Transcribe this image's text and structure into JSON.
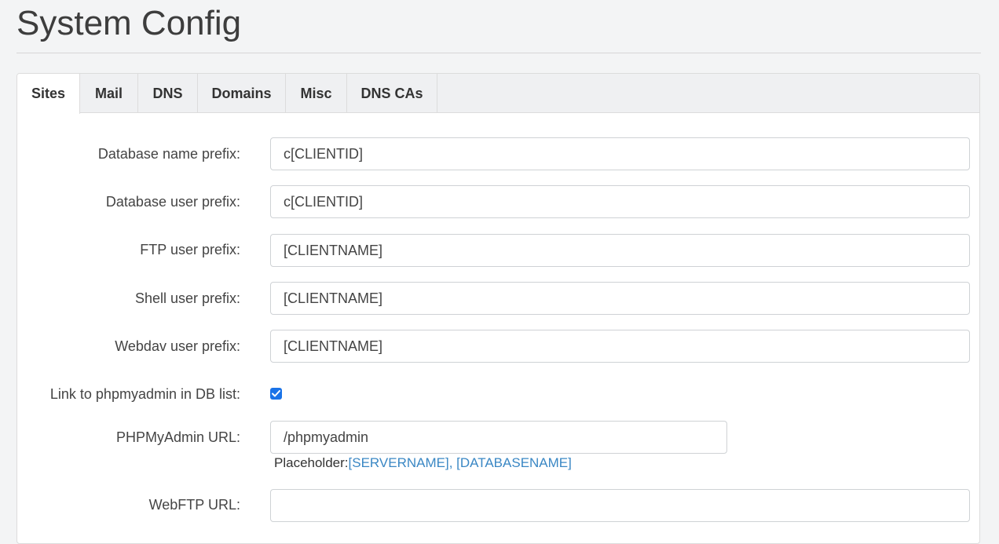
{
  "page": {
    "title": "System Config"
  },
  "tabs": [
    {
      "label": "Sites",
      "active": true
    },
    {
      "label": "Mail",
      "active": false
    },
    {
      "label": "DNS",
      "active": false
    },
    {
      "label": "Domains",
      "active": false
    },
    {
      "label": "Misc",
      "active": false
    },
    {
      "label": "DNS CAs",
      "active": false
    }
  ],
  "form": {
    "db_name_prefix": {
      "label": "Database name prefix:",
      "value": "c[CLIENTID]"
    },
    "db_user_prefix": {
      "label": "Database user prefix:",
      "value": "c[CLIENTID]"
    },
    "ftp_user_prefix": {
      "label": "FTP user prefix:",
      "value": "[CLIENTNAME]"
    },
    "shell_user_prefix": {
      "label": "Shell user prefix:",
      "value": "[CLIENTNAME]"
    },
    "webdav_user_prefix": {
      "label": "Webdav user prefix:",
      "value": "[CLIENTNAME]"
    },
    "phpmyadmin_link": {
      "label": "Link to phpmyadmin in DB list:",
      "checked": true
    },
    "phpmyadmin_url": {
      "label": "PHPMyAdmin URL:",
      "value": "/phpmyadmin",
      "hint_prefix": "Placeholder:",
      "hint_placeholder_1": "[SERVERNAME]",
      "hint_separator": ", ",
      "hint_placeholder_2": "[DATABASENAME]"
    },
    "webftp_url": {
      "label": "WebFTP URL:",
      "value": ""
    }
  },
  "colors": {
    "accent": "#1a73e8",
    "link": "#3a87c4",
    "page_bg": "#f3f4f5",
    "tab_bar_bg": "#eff0f2"
  },
  "icons": {
    "checkbox": "checkmark-icon"
  }
}
